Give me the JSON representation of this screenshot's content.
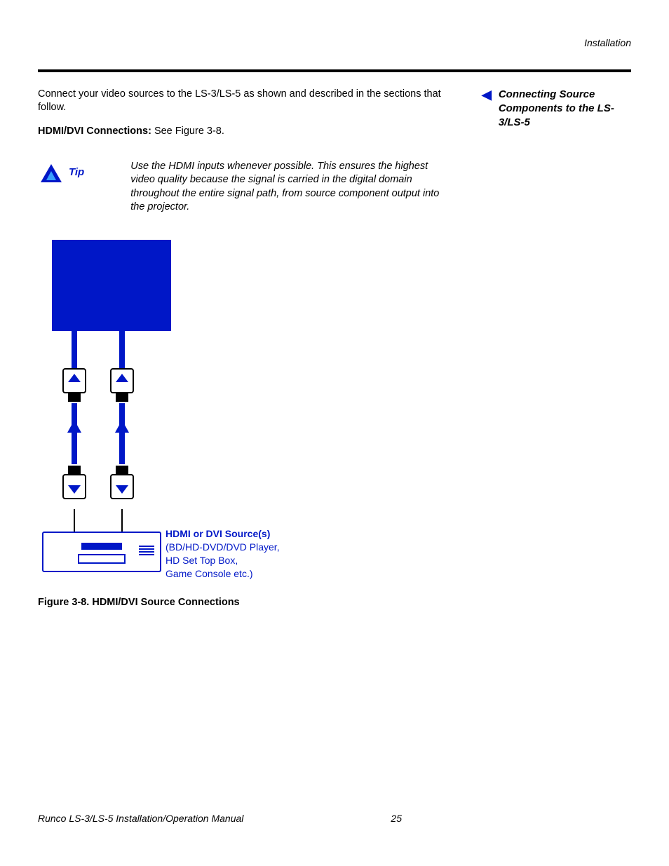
{
  "header": {
    "section": "Installation"
  },
  "main": {
    "intro": "Connect your video sources to the LS-3/LS-5 as shown and described in the sections that follow.",
    "hdmi_label": "HDMI/DVI Connections:",
    "hdmi_ref": " See Figure 3-8."
  },
  "side": {
    "heading": "Connecting Source Components to the LS-3/LS-5"
  },
  "tip": {
    "label": "Tip",
    "text": "Use the HDMI inputs whenever possible. This ensures the highest video quality because the signal is carried in the digital domain throughout the entire signal path, from source component output into the projector."
  },
  "figure": {
    "source_title": "HDMI or DVI Source(s)",
    "source_line1": "(BD/HD-DVD/DVD Player,",
    "source_line2": "HD Set Top Box,",
    "source_line3": "Game Console etc.)",
    "caption": "Figure 3-8. HDMI/DVI Source Connections"
  },
  "footer": {
    "manual": "Runco LS-3/LS-5 Installation/Operation Manual",
    "page": "25"
  }
}
